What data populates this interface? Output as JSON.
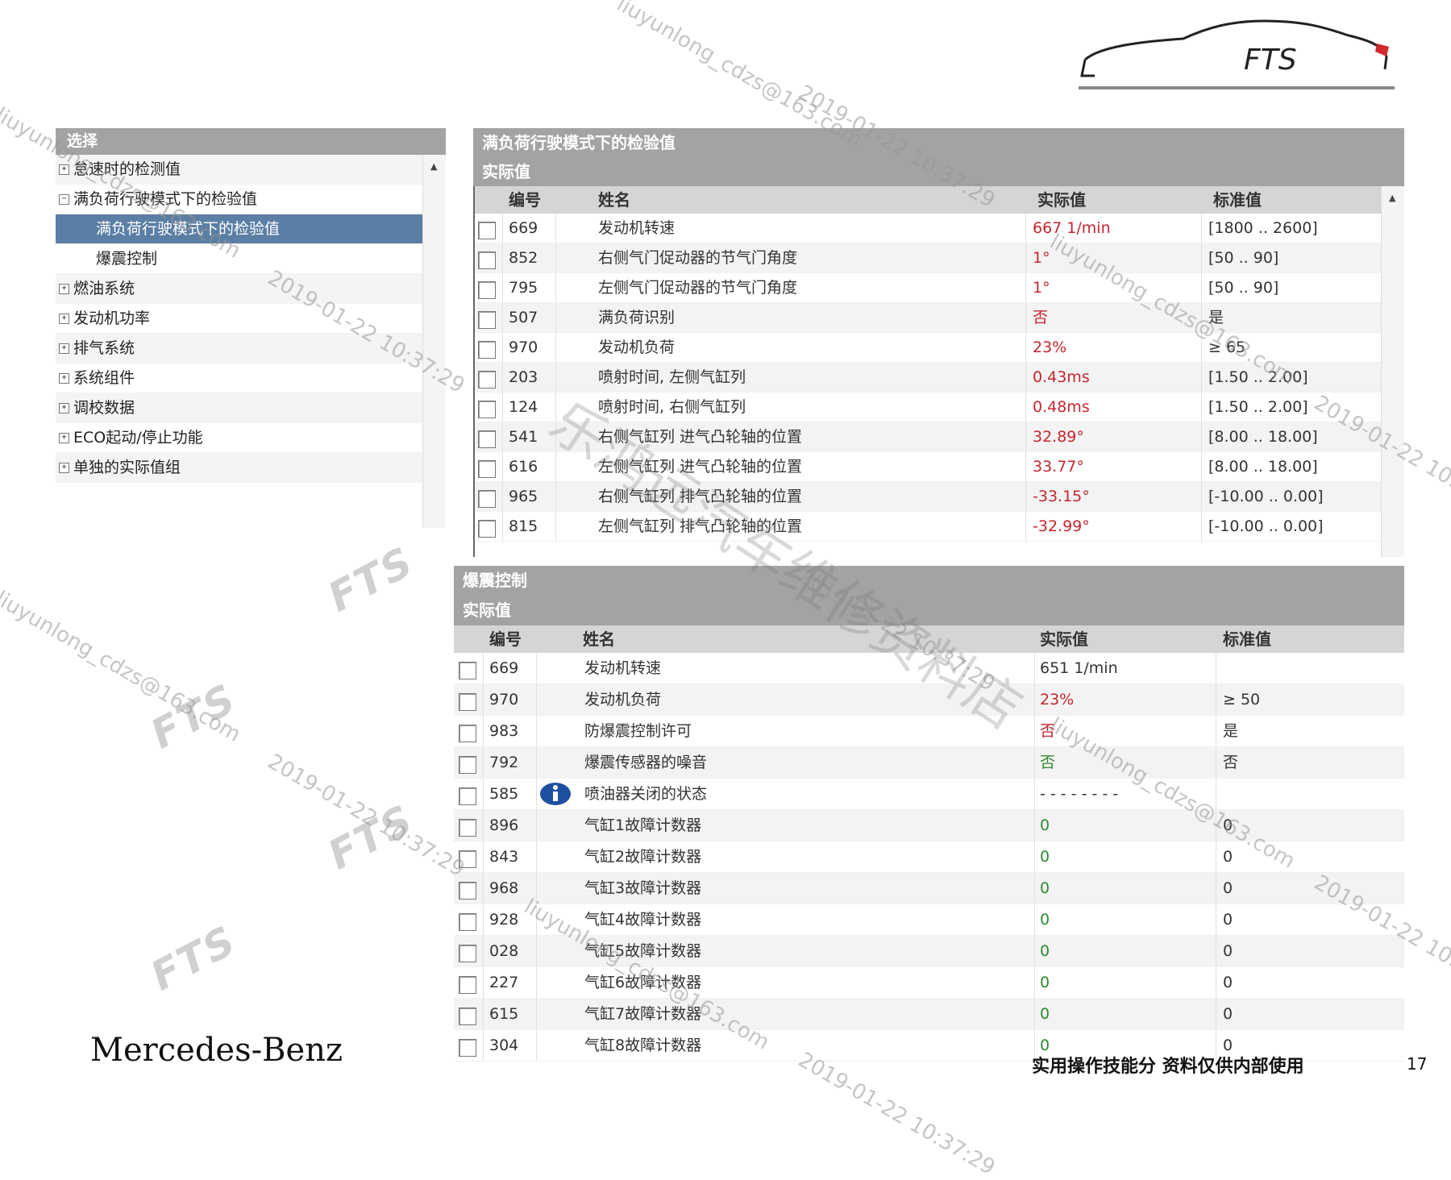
{
  "logo": {
    "text": "FTS"
  },
  "tree": {
    "header": "选择",
    "items": [
      {
        "label": "怠速时的检测值",
        "expander": "+",
        "level": 0
      },
      {
        "label": "满负荷行驶模式下的检验值",
        "expander": "−",
        "level": 0
      },
      {
        "label": "满负荷行驶模式下的检验值",
        "level": 1,
        "selected": true
      },
      {
        "label": "爆震控制",
        "level": 1
      },
      {
        "label": "燃油系统",
        "expander": "+",
        "level": 0
      },
      {
        "label": "发动机功率",
        "expander": "+",
        "level": 0
      },
      {
        "label": "排气系统",
        "expander": "+",
        "level": 0
      },
      {
        "label": "系统组件",
        "expander": "+",
        "level": 0
      },
      {
        "label": "调校数据",
        "expander": "+",
        "level": 0
      },
      {
        "label": "ECO起动/停止功能",
        "expander": "+",
        "level": 0
      },
      {
        "label": "单独的实际值组",
        "expander": "+",
        "level": 0
      }
    ],
    "scroll_icon": "scroll-up-arrow"
  },
  "panel1": {
    "title": "满负荷行驶模式下的检验值",
    "subtitle": "实际值",
    "columns": {
      "id": "编号",
      "name": "姓名",
      "actual": "实际值",
      "standard": "标准值"
    },
    "rows": [
      {
        "id": "669",
        "name": "发动机转速",
        "actual": "667 1/min",
        "actual_color": "red",
        "standard": "[1800 .. 2600]"
      },
      {
        "id": "852",
        "name": "右侧气门促动器的节气门角度",
        "actual": "1°",
        "actual_color": "red",
        "standard": "[50 .. 90]"
      },
      {
        "id": "795",
        "name": "左侧气门促动器的节气门角度",
        "actual": "1°",
        "actual_color": "red",
        "standard": "[50 .. 90]"
      },
      {
        "id": "507",
        "name": "满负荷识别",
        "actual": "否",
        "actual_color": "red",
        "standard": "是"
      },
      {
        "id": "970",
        "name": "发动机负荷",
        "actual": "23%",
        "actual_color": "red",
        "standard": "≥ 65"
      },
      {
        "id": "203",
        "name": "喷射时间, 左侧气缸列",
        "actual": "0.43ms",
        "actual_color": "red",
        "standard": "[1.50 .. 2.00]"
      },
      {
        "id": "124",
        "name": "喷射时间, 右侧气缸列",
        "actual": "0.48ms",
        "actual_color": "red",
        "standard": "[1.50 .. 2.00]"
      },
      {
        "id": "541",
        "name": "右侧气缸列 进气凸轮轴的位置",
        "actual": "32.89°",
        "actual_color": "red",
        "standard": "[8.00 .. 18.00]"
      },
      {
        "id": "616",
        "name": "左侧气缸列 进气凸轮轴的位置",
        "actual": "33.77°",
        "actual_color": "red",
        "standard": "[8.00 .. 18.00]"
      },
      {
        "id": "965",
        "name": "右侧气缸列 排气凸轮轴的位置",
        "actual": "-33.15°",
        "actual_color": "red",
        "standard": "[-10.00 .. 0.00]"
      },
      {
        "id": "815",
        "name": "左侧气缸列 排气凸轮轴的位置",
        "actual": "-32.99°",
        "actual_color": "red",
        "standard": "[-10.00 .. 0.00]"
      }
    ]
  },
  "panel2": {
    "title": "爆震控制",
    "subtitle": "实际值",
    "columns": {
      "id": "编号",
      "name": "姓名",
      "actual": "实际值",
      "standard": "标准值"
    },
    "rows": [
      {
        "id": "669",
        "name": "发动机转速",
        "actual": "651 1/min",
        "actual_color": "normal",
        "standard": ""
      },
      {
        "id": "970",
        "name": "发动机负荷",
        "actual": "23%",
        "actual_color": "red",
        "standard": "≥ 50"
      },
      {
        "id": "983",
        "name": "防爆震控制许可",
        "actual": "否",
        "actual_color": "red",
        "standard": "是"
      },
      {
        "id": "792",
        "name": "爆震传感器的噪音",
        "actual": "否",
        "actual_color": "green",
        "standard": "否"
      },
      {
        "id": "585",
        "name": "喷油器关闭的状态",
        "actual": "- - - - - - - -",
        "actual_color": "normal",
        "standard": "",
        "icon": "info-icon"
      },
      {
        "id": "896",
        "name": "气缸1故障计数器",
        "actual": "0",
        "actual_color": "green",
        "standard": "0"
      },
      {
        "id": "843",
        "name": "气缸2故障计数器",
        "actual": "0",
        "actual_color": "green",
        "standard": "0"
      },
      {
        "id": "968",
        "name": "气缸3故障计数器",
        "actual": "0",
        "actual_color": "green",
        "standard": "0"
      },
      {
        "id": "928",
        "name": "气缸4故障计数器",
        "actual": "0",
        "actual_color": "green",
        "standard": "0"
      },
      {
        "id": "028",
        "name": "气缸5故障计数器",
        "actual": "0",
        "actual_color": "green",
        "standard": "0"
      },
      {
        "id": "227",
        "name": "气缸6故障计数器",
        "actual": "0",
        "actual_color": "green",
        "standard": "0"
      },
      {
        "id": "615",
        "name": "气缸7故障计数器",
        "actual": "0",
        "actual_color": "green",
        "standard": "0"
      },
      {
        "id": "304",
        "name": "气缸8故障计数器",
        "actual": "0",
        "actual_color": "green",
        "standard": "0"
      }
    ]
  },
  "watermarks": {
    "email": "liuyunlong_cdzs@163.com",
    "date": "2019-01-22 10:37:29",
    "fts": "FTS",
    "cn": "乐鸿远汽车维修资料店"
  },
  "footer": {
    "brand": "Mercedes-Benz",
    "note": "实用操作技能分 资料仅供内部使用",
    "page": "17"
  },
  "colors": {
    "header_gray": "#a3a3a3",
    "selected_blue": "#5b7ea4",
    "red_value": "#c4262e",
    "green_value": "#2f8a2f",
    "info_blue": "#1f4fa0"
  }
}
